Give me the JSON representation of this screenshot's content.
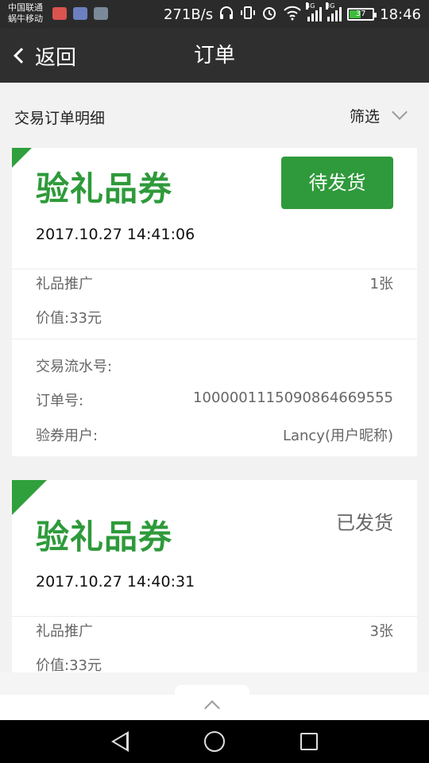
{
  "statusbar": {
    "carrier_1": "中国联通",
    "carrier_2": "蜗牛移动",
    "net_speed": "271B/s",
    "net_4g": "4G",
    "net_3g": "3G",
    "battery_level": "37",
    "time": "18:46"
  },
  "navbar": {
    "back_label": "返回",
    "title": "订单"
  },
  "filter": {
    "section_title": "交易订单明细",
    "filter_label": "筛选"
  },
  "orders": [
    {
      "title": "验礼品券",
      "status": "待发货",
      "datetime": "2017.10.27 14:41:06",
      "product_name": "礼品推广",
      "quantity": "1张",
      "value": "价值:33元",
      "serial_label": "交易流水号:",
      "order_no_label": "订单号:",
      "order_no": "1000001115090864669555",
      "user_label": "验券用户:",
      "user": "Lancy(用户昵称)"
    },
    {
      "title": "验礼品券",
      "status": "已发货",
      "datetime": "2017.10.27 14:40:31",
      "product_name": "礼品推广",
      "quantity": "3张",
      "value": "价值:33元"
    }
  ],
  "colors": {
    "brand_green": "#2f9a3b",
    "navbar": "#2f2f2f",
    "background": "#f2f2f2"
  },
  "icons": {
    "back": "chevron-left-icon",
    "filter": "chevron-down-icon",
    "scroll_top": "chevron-up-icon"
  }
}
